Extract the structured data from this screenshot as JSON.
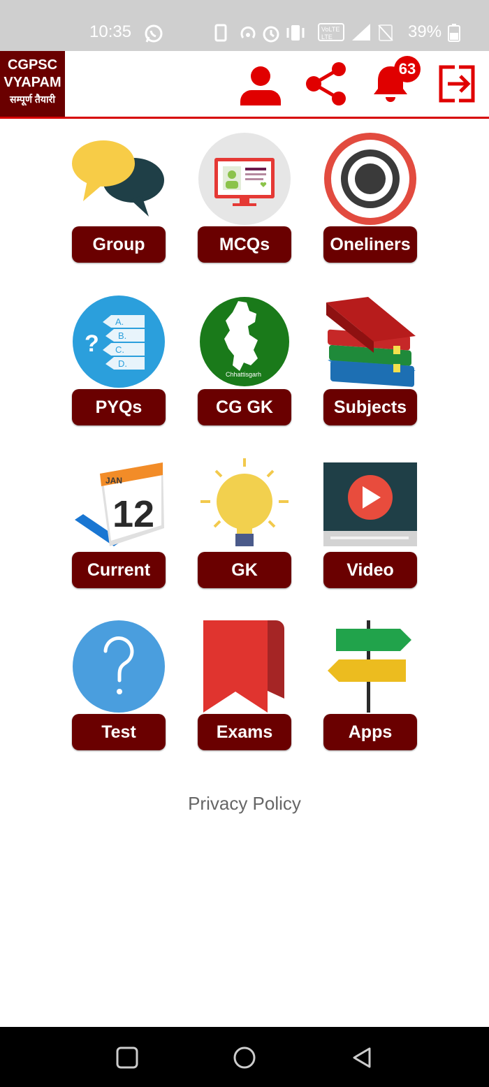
{
  "status_bar": {
    "time": "10:35",
    "battery": "39%",
    "icons": [
      "whatsapp-icon",
      "sim-icon",
      "hotspot-icon",
      "alarm-icon",
      "vibrate-icon",
      "volte-icon",
      "signal-icon",
      "no-sim-icon",
      "battery-icon"
    ]
  },
  "app_bar": {
    "logo": {
      "line1": "CGPSC",
      "line2": "VYAPAM",
      "line3": "सम्पूर्ण तैयारी"
    },
    "notification_count": "63",
    "icons": [
      "profile-icon",
      "share-icon",
      "bell-icon",
      "logout-icon"
    ],
    "accent_color": "#e00000"
  },
  "grid": {
    "items": [
      {
        "label": "Group",
        "icon": "chat-bubbles-icon"
      },
      {
        "label": "MCQs",
        "icon": "monitor-icon"
      },
      {
        "label": "Oneliners",
        "icon": "target-icon"
      },
      {
        "label": "PYQs",
        "icon": "question-options-icon"
      },
      {
        "label": "CG GK",
        "icon": "chhattisgarh-map-icon",
        "sub_text": "Chhattisgarh"
      },
      {
        "label": "Subjects",
        "icon": "books-icon"
      },
      {
        "label": "Current",
        "icon": "calendar-icon",
        "calendar_month": "JAN",
        "calendar_day": "12"
      },
      {
        "label": "GK",
        "icon": "lightbulb-icon"
      },
      {
        "label": "Video",
        "icon": "video-play-icon"
      },
      {
        "label": "Test",
        "icon": "question-mark-icon"
      },
      {
        "label": "Exams",
        "icon": "bookmark-icon"
      },
      {
        "label": "Apps",
        "icon": "signpost-icon"
      }
    ],
    "label_color": "#6a0000"
  },
  "footer": {
    "privacy_policy": "Privacy Policy"
  },
  "nav_bar": {
    "buttons": [
      "recents-button",
      "home-button",
      "back-button"
    ]
  }
}
